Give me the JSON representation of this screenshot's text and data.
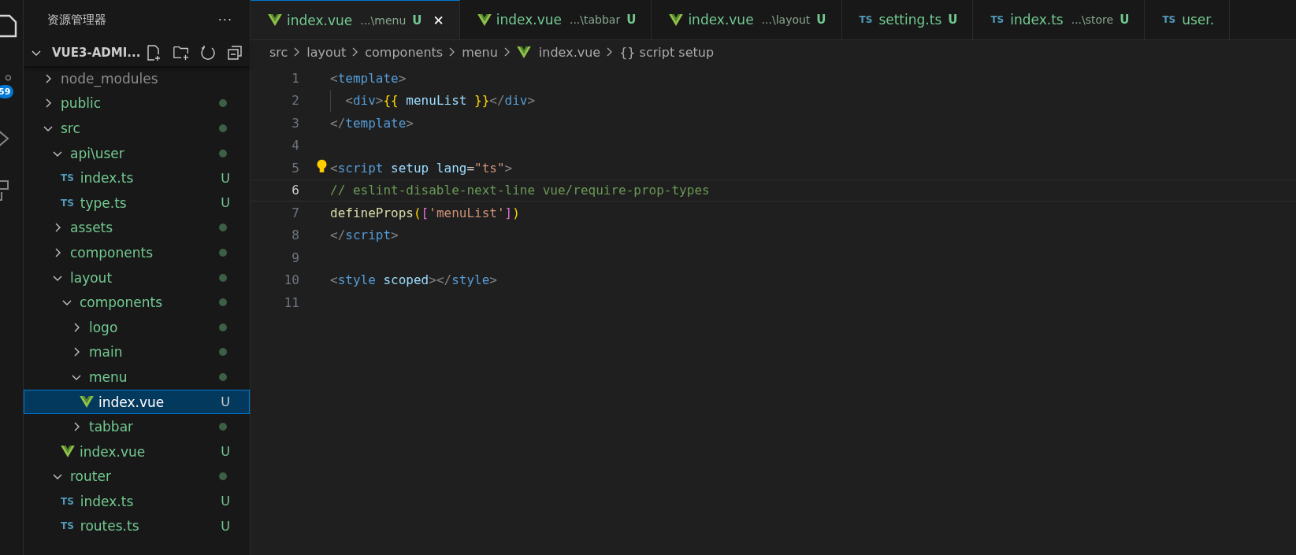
{
  "activity_bar": {
    "scm_badge": "59"
  },
  "explorer": {
    "title": "资源管理器",
    "more": "···",
    "root": {
      "label": "VUE3-ADMI...",
      "expanded": true
    },
    "tree": [
      {
        "label": "node_modules",
        "kind": "folder",
        "expanded": false,
        "ignored": true
      },
      {
        "label": "public",
        "kind": "folder",
        "expanded": false,
        "dot": true
      },
      {
        "label": "src",
        "kind": "folder",
        "expanded": true,
        "dot": true,
        "children": [
          {
            "label": "api\\user",
            "kind": "folder",
            "expanded": true,
            "dot": true,
            "children": [
              {
                "label": "index.ts",
                "kind": "ts",
                "icon": "TS",
                "badge": "U"
              },
              {
                "label": "type.ts",
                "kind": "ts",
                "icon": "TS",
                "badge": "U"
              }
            ]
          },
          {
            "label": "assets",
            "kind": "folder",
            "expanded": false,
            "dot": true
          },
          {
            "label": "components",
            "kind": "folder",
            "expanded": false,
            "dot": true
          },
          {
            "label": "layout",
            "kind": "folder",
            "expanded": true,
            "dot": true,
            "children": [
              {
                "label": "components",
                "kind": "folder",
                "expanded": true,
                "dot": true,
                "children": [
                  {
                    "label": "logo",
                    "kind": "folder",
                    "expanded": false,
                    "dot": true
                  },
                  {
                    "label": "main",
                    "kind": "folder",
                    "expanded": false,
                    "dot": true
                  },
                  {
                    "label": "menu",
                    "kind": "folder",
                    "expanded": true,
                    "dot": true,
                    "children": [
                      {
                        "label": "index.vue",
                        "kind": "vue",
                        "badge": "U",
                        "selected": true
                      }
                    ]
                  },
                  {
                    "label": "tabbar",
                    "kind": "folder",
                    "expanded": false,
                    "dot": true
                  }
                ]
              },
              {
                "label": "index.vue",
                "kind": "vue",
                "badge": "U"
              }
            ]
          },
          {
            "label": "router",
            "kind": "folder",
            "expanded": true,
            "dot": true,
            "children": [
              {
                "label": "index.ts",
                "kind": "ts",
                "icon": "TS",
                "badge": "U"
              },
              {
                "label": "routes.ts",
                "kind": "ts",
                "icon": "TS",
                "badge": "U"
              }
            ]
          }
        ]
      }
    ]
  },
  "tabs": [
    {
      "label": "index.vue",
      "kind": "vue",
      "description": "...\\menu",
      "badge": "U",
      "selected": true,
      "close": "✕"
    },
    {
      "label": "index.vue",
      "kind": "vue",
      "description": "...\\tabbar",
      "badge": "U",
      "selected": false
    },
    {
      "label": "index.vue",
      "kind": "vue",
      "description": "...\\layout",
      "badge": "U",
      "selected": false
    },
    {
      "label": "setting.ts",
      "kind": "ts",
      "icon": "TS",
      "badge": "U",
      "selected": false
    },
    {
      "label": "index.ts",
      "kind": "ts",
      "icon": "TS",
      "description": "...\\store",
      "badge": "U",
      "selected": false
    },
    {
      "label": "user.",
      "kind": "ts",
      "icon": "TS",
      "selected": false
    }
  ],
  "breadcrumb": [
    {
      "label": "src",
      "kind": "folder"
    },
    {
      "label": "layout",
      "kind": "folder"
    },
    {
      "label": "components",
      "kind": "folder"
    },
    {
      "label": "menu",
      "kind": "folder"
    },
    {
      "label": "index.vue",
      "kind": "vue"
    },
    {
      "label": "{} script setup",
      "kind": "symbol"
    }
  ],
  "editor": {
    "lines": [
      {
        "number": "1",
        "tokens": [
          {
            "text": "<",
            "kind": "punct"
          },
          {
            "text": "template",
            "kind": "tag"
          },
          {
            "text": ">",
            "kind": "punct"
          }
        ]
      },
      {
        "number": "2",
        "guide": true,
        "tokens": [
          {
            "text": "  <",
            "kind": "punct"
          },
          {
            "text": "div",
            "kind": "tag"
          },
          {
            "text": ">",
            "kind": "punct"
          },
          {
            "text": "{{",
            "kind": "brace"
          },
          {
            "text": " menuList ",
            "kind": "var"
          },
          {
            "text": "}}",
            "kind": "brace"
          },
          {
            "text": "</",
            "kind": "punct"
          },
          {
            "text": "div",
            "kind": "tag"
          },
          {
            "text": ">",
            "kind": "punct"
          }
        ]
      },
      {
        "number": "3",
        "tokens": [
          {
            "text": "</",
            "kind": "punct"
          },
          {
            "text": "template",
            "kind": "tag"
          },
          {
            "text": ">",
            "kind": "punct"
          }
        ]
      },
      {
        "number": "4"
      },
      {
        "number": "5",
        "lightbulb": true,
        "tokens": [
          {
            "text": "<",
            "kind": "punct"
          },
          {
            "text": "script",
            "kind": "tag"
          },
          {
            "text": " setup",
            "kind": "attr"
          },
          {
            "text": " lang",
            "kind": "attr"
          },
          {
            "text": "=",
            "kind": "plain"
          },
          {
            "text": "\"ts\"",
            "kind": "string"
          },
          {
            "text": ">",
            "kind": "punct"
          }
        ]
      },
      {
        "number": "6",
        "current": true,
        "tokens": [
          {
            "text": "// eslint-disable-next-line vue/require-prop-types",
            "kind": "comment"
          }
        ]
      },
      {
        "number": "7",
        "tokens": [
          {
            "text": "defineProps",
            "kind": "fn"
          },
          {
            "text": "(",
            "kind": "brace"
          },
          {
            "text": "[",
            "kind": "bracket"
          },
          {
            "text": "'menuList'",
            "kind": "string"
          },
          {
            "text": "]",
            "kind": "bracket"
          },
          {
            "text": ")",
            "kind": "brace"
          }
        ]
      },
      {
        "number": "8",
        "tokens": [
          {
            "text": "</",
            "kind": "punct"
          },
          {
            "text": "script",
            "kind": "tag"
          },
          {
            "text": ">",
            "kind": "punct"
          }
        ]
      },
      {
        "number": "9"
      },
      {
        "number": "10",
        "tokens": [
          {
            "text": "<",
            "kind": "punct"
          },
          {
            "text": "style",
            "kind": "tag"
          },
          {
            "text": " scoped",
            "kind": "attr"
          },
          {
            "text": "></",
            "kind": "punct"
          },
          {
            "text": "style",
            "kind": "tag"
          },
          {
            "text": ">",
            "kind": "punct"
          }
        ]
      },
      {
        "number": "11"
      }
    ]
  }
}
